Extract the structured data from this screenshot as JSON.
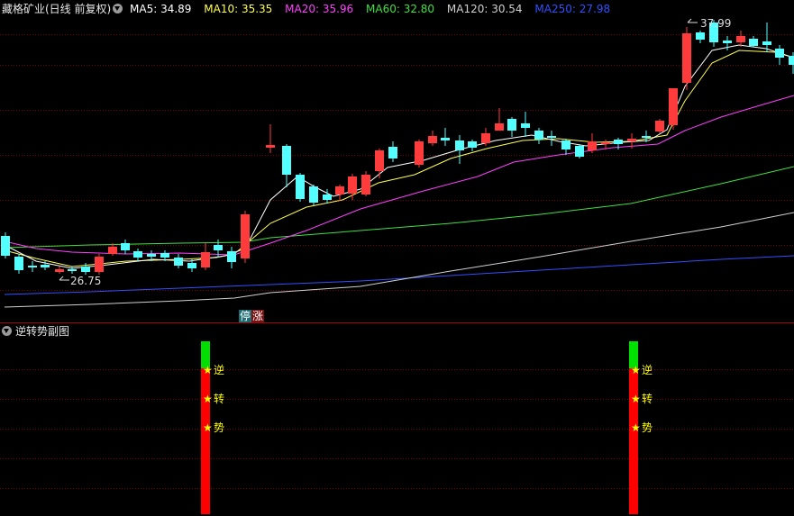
{
  "header": {
    "title": "藏格矿业(日线 前复权)",
    "dropdown_icon": "chevron-down-icon",
    "ma": [
      {
        "label": "MA5: 34.89",
        "color": "#ffffff"
      },
      {
        "label": "MA10: 35.35",
        "color": "#ffff4f"
      },
      {
        "label": "MA20: 35.96",
        "color": "#ff40ff"
      },
      {
        "label": "MA60: 32.80",
        "color": "#40e040"
      },
      {
        "label": "MA120: 30.54",
        "color": "#d0d0d0"
      },
      {
        "label": "MA250: 27.98",
        "color": "#3050ff"
      }
    ]
  },
  "main_chart": {
    "high_label": "37.99",
    "low_label": "26.75",
    "limit_badge": {
      "left": "停",
      "right": "涨"
    },
    "colors": {
      "up": "#ff3b3b",
      "down": "#54ffff",
      "grid": "#7a0000"
    }
  },
  "sub_panel": {
    "title": "逆转势副图",
    "dropdown_icon": "chevron-down-icon",
    "signal_labels": [
      "逆",
      "转",
      "势"
    ],
    "star_icon": "star-icon",
    "colors": {
      "bar": "#ff0000",
      "top": "#00e000",
      "star": "#ffff00"
    }
  }
}
